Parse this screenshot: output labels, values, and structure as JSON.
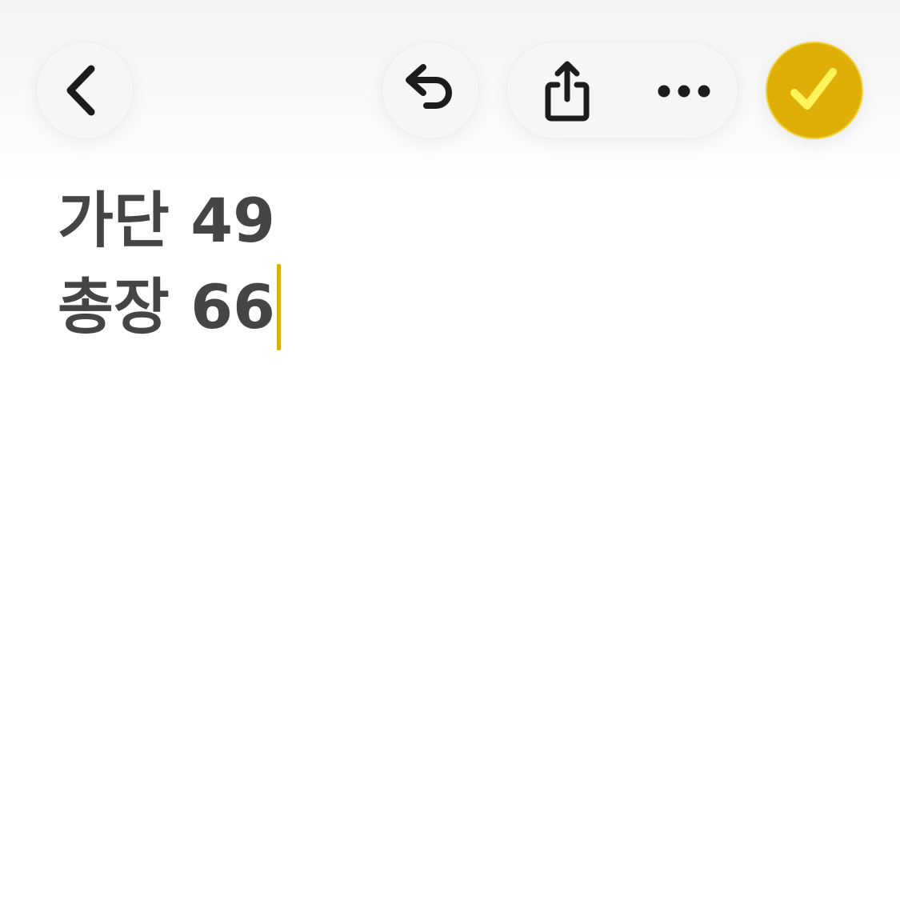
{
  "note": {
    "lines": [
      "가단 49",
      "총장 66"
    ]
  },
  "toolbar": {
    "icons": {
      "back": "chevron-left-icon",
      "undo": "undo-icon",
      "share": "share-icon",
      "more": "ellipsis-icon",
      "done": "checkmark-icon"
    }
  },
  "colors": {
    "accent": "#dfaf07",
    "check": "#fff35a",
    "text": "#454545",
    "button_bg": "#f6f6f6"
  }
}
